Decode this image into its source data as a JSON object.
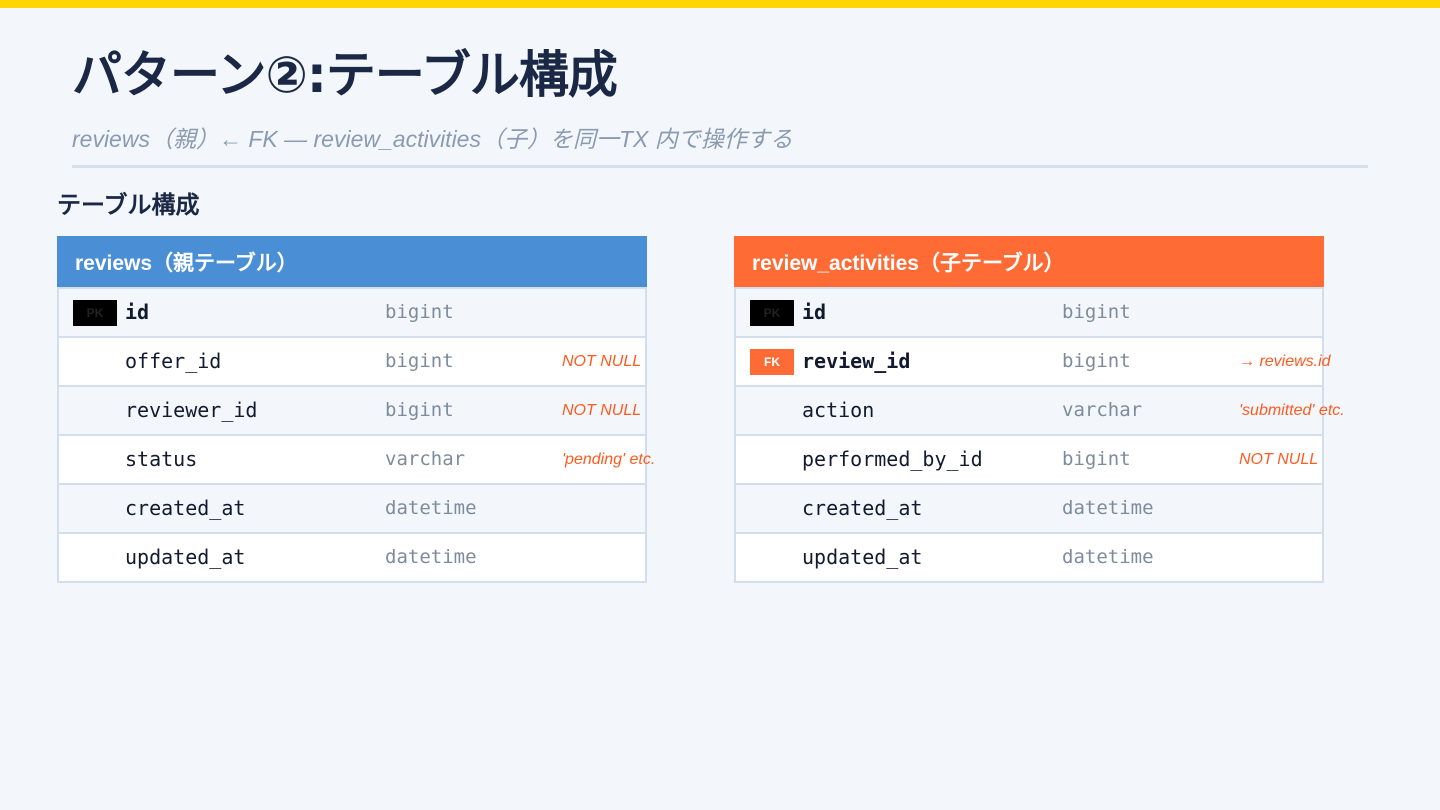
{
  "slide": {
    "title": "パターン②:テーブル構成",
    "subtitle": "reviews（親）← FK — review_activities（子）を同一TX 内で操作する",
    "section_heading": "テーブル構成"
  },
  "colors": {
    "top_bar": "#ffd600",
    "parent_header": "#4a8fd6",
    "child_header": "#ff6b35",
    "note_text": "#ff5a1f",
    "title_text": "#1a2745"
  },
  "tables": {
    "parent": {
      "name": "reviews（親テーブル）",
      "rows": [
        {
          "badge": "PK",
          "column": "id",
          "type": "bigint",
          "note": ""
        },
        {
          "badge": "",
          "column": "offer_id",
          "type": "bigint",
          "note": "NOT NULL"
        },
        {
          "badge": "",
          "column": "reviewer_id",
          "type": "bigint",
          "note": "NOT NULL"
        },
        {
          "badge": "",
          "column": "status",
          "type": "varchar",
          "note": "'pending' etc."
        },
        {
          "badge": "",
          "column": "created_at",
          "type": "datetime",
          "note": ""
        },
        {
          "badge": "",
          "column": "updated_at",
          "type": "datetime",
          "note": ""
        }
      ]
    },
    "child": {
      "name": "review_activities（子テーブル）",
      "rows": [
        {
          "badge": "PK",
          "column": "id",
          "type": "bigint",
          "note": ""
        },
        {
          "badge": "FK",
          "column": "review_id",
          "type": "bigint",
          "note": "→ reviews.id"
        },
        {
          "badge": "",
          "column": "action",
          "type": "varchar",
          "note": "'submitted' etc."
        },
        {
          "badge": "",
          "column": "performed_by_id",
          "type": "bigint",
          "note": "NOT NULL"
        },
        {
          "badge": "",
          "column": "created_at",
          "type": "datetime",
          "note": ""
        },
        {
          "badge": "",
          "column": "updated_at",
          "type": "datetime",
          "note": ""
        }
      ]
    }
  }
}
